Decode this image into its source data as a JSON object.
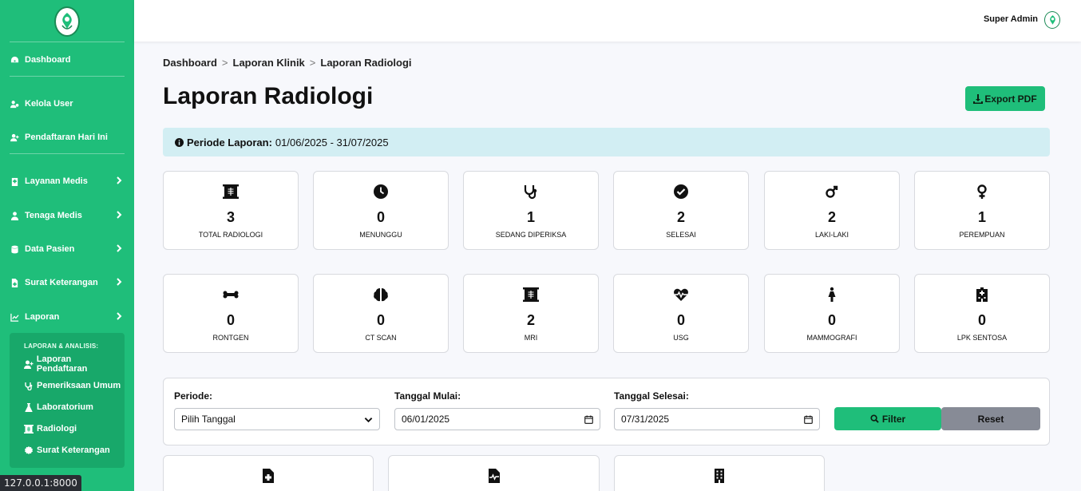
{
  "sidebar": {
    "items": [
      {
        "label": "Dashboard"
      },
      {
        "label": "Kelola User"
      },
      {
        "label": "Pendaftaran Hari Ini"
      },
      {
        "label": "Layanan Medis"
      },
      {
        "label": "Tenaga Medis"
      },
      {
        "label": "Data Pasien"
      },
      {
        "label": "Surat Keterangan"
      },
      {
        "label": "Laporan"
      }
    ],
    "submenu": {
      "heading": "LAPORAN & ANALISIS:",
      "items": [
        {
          "label": "Laporan Pendaftaran"
        },
        {
          "label": "Pemeriksaan Umum"
        },
        {
          "label": "Laboratorium"
        },
        {
          "label": "Radiologi"
        },
        {
          "label": "Surat Keterangan"
        }
      ]
    }
  },
  "topbar": {
    "user_name": "Super Admin"
  },
  "breadcrumb": [
    "Dashboard",
    "Laporan Klinik",
    "Laporan Radiologi"
  ],
  "breadcrumb_sep": ">",
  "page_title": "Laporan Radiologi",
  "export_label": "Export PDF",
  "alert": {
    "label": "Periode Laporan:",
    "value": "01/06/2025 - 31/07/2025"
  },
  "stats_row1": [
    {
      "icon": "x-ray-icon",
      "value": "3",
      "label": "TOTAL RADIOLOGI"
    },
    {
      "icon": "clock-icon",
      "value": "0",
      "label": "MENUNGGU"
    },
    {
      "icon": "stethoscope-icon",
      "value": "1",
      "label": "SEDANG DIPERIKSA"
    },
    {
      "icon": "check-circle-icon",
      "value": "2",
      "label": "SELESAI"
    },
    {
      "icon": "mars-icon",
      "value": "2",
      "label": "LAKI-LAKI"
    },
    {
      "icon": "venus-icon",
      "value": "1",
      "label": "PEREMPUAN"
    }
  ],
  "stats_row2": [
    {
      "icon": "bone-icon",
      "value": "0",
      "label": "RONTGEN"
    },
    {
      "icon": "brain-icon",
      "value": "0",
      "label": "CT SCAN"
    },
    {
      "icon": "x-ray-icon",
      "value": "2",
      "label": "MRI"
    },
    {
      "icon": "heart-pulse-icon",
      "value": "0",
      "label": "USG"
    },
    {
      "icon": "person-dress-icon",
      "value": "0",
      "label": "MAMMOGRAFI"
    },
    {
      "icon": "hospital-icon",
      "value": "0",
      "label": "LPK SENTOSA"
    }
  ],
  "filter": {
    "periode_label": "Periode:",
    "periode_value": "Pilih Tanggal",
    "start_label": "Tanggal Mulai:",
    "start_value": "06/01/2025",
    "end_label": "Tanggal Selesai:",
    "end_value": "07/31/2025",
    "filter_button": "Filter",
    "reset_button": "Reset"
  },
  "status_url": "127.0.0.1:8000",
  "colors": {
    "primary": "#1fbe7a",
    "alert_bg": "#d2eef3",
    "reset_bg": "#878b96"
  }
}
